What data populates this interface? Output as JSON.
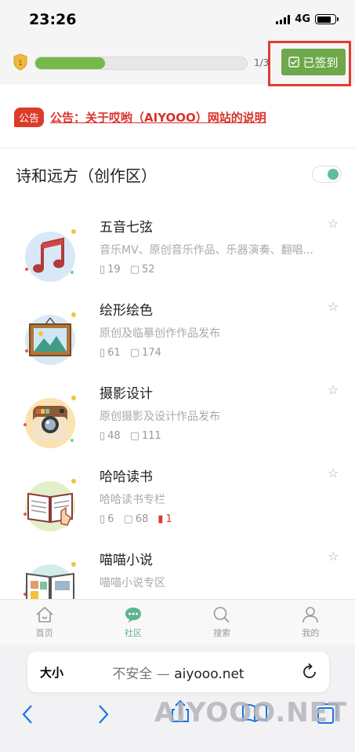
{
  "status": {
    "time": "23:26",
    "network": "4G",
    "battery_level": 0.8
  },
  "level": {
    "badge": "1",
    "progress": 0.33,
    "count": "1/3"
  },
  "checkin": {
    "label": "已签到",
    "icon": "check-square-icon"
  },
  "announcement": {
    "tag": "公告",
    "text": "公告：关于哎哟（AIYOOO）网站的说明"
  },
  "section": {
    "title": "诗和远方（创作区）",
    "toggle_on": true
  },
  "forums": [
    {
      "name": "五音七弦",
      "desc": "音乐MV、原创音乐作品、乐器演奏、翻唱...",
      "threads": "19",
      "posts": "52",
      "icon": "music-note-icon"
    },
    {
      "name": "绘形绘色",
      "desc": "原创及临摹创作作品发布",
      "threads": "61",
      "posts": "174",
      "icon": "picture-frame-icon"
    },
    {
      "name": "摄影设计",
      "desc": "原创摄影及设计作品发布",
      "threads": "48",
      "posts": "111",
      "icon": "camera-icon"
    },
    {
      "name": "哈哈读书",
      "desc": "哈哈读书专栏",
      "threads": "6",
      "posts": "68",
      "new": "1",
      "icon": "open-book-icon"
    },
    {
      "name": "喵喵小说",
      "desc": "喵喵小说专区",
      "icon": "comic-book-icon"
    }
  ],
  "tabs": [
    {
      "label": "首页",
      "icon": "home-icon"
    },
    {
      "label": "社区",
      "icon": "chat-bubble-icon"
    },
    {
      "label": "搜索",
      "icon": "search-icon"
    },
    {
      "label": "我的",
      "icon": "user-icon"
    }
  ],
  "browser": {
    "aa": "大小",
    "insecure": "不安全 — ",
    "domain": "aiyooo.net"
  },
  "watermark": "AIYOOO.NET",
  "colors": {
    "accent": "#6ea84a",
    "alert": "#dd3a2a",
    "active_tab": "#5fb48f"
  }
}
